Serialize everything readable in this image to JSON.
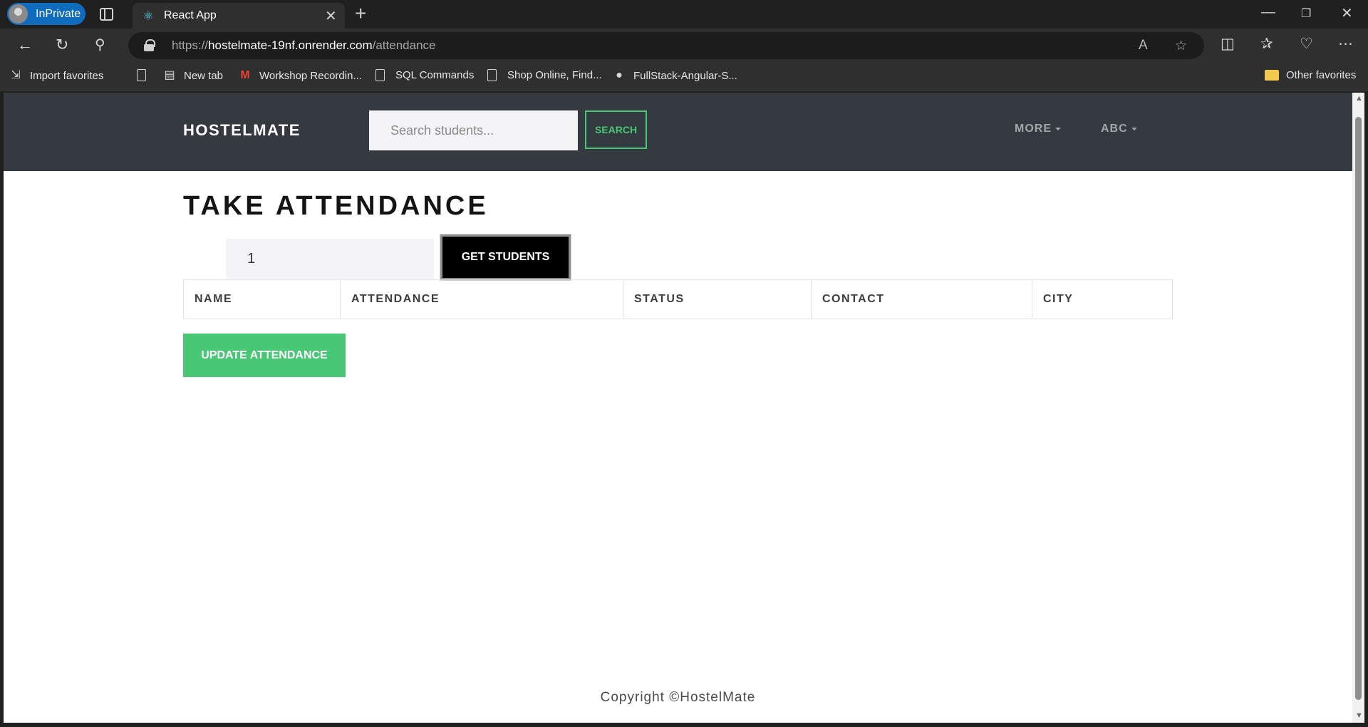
{
  "browser": {
    "profile_label": "InPrivate",
    "tab_title": "React App",
    "url_scheme": "https://",
    "url_host": "hostelmate-19nf.onrender.com",
    "url_path": "/attendance",
    "bookmarks": [
      {
        "label": "Import favorites"
      },
      {
        "label": ""
      },
      {
        "label": "New tab"
      },
      {
        "label": "Workshop Recordin..."
      },
      {
        "label": "SQL Commands"
      },
      {
        "label": "Shop Online, Find..."
      },
      {
        "label": "FullStack-Angular-S..."
      }
    ],
    "other_favorites": "Other favorites"
  },
  "navbar": {
    "brand": "HOSTELMATE",
    "search_placeholder": "Search students...",
    "search_button": "SEARCH",
    "menu_more": "MORE",
    "menu_user": "ABC"
  },
  "main": {
    "title": "TAKE ATTENDANCE",
    "room_value": "1",
    "get_students_button": "GET STUDENTS",
    "table_headers": [
      "NAME",
      "ATTENDANCE",
      "STATUS",
      "CONTACT",
      "CITY"
    ],
    "update_button": "UPDATE ATTENDANCE"
  },
  "footer": {
    "copyright": "Copyright ©HostelMate"
  },
  "colors": {
    "navbar_bg": "#343a40",
    "accent_green": "#48c774",
    "browser_blue": "#0f6cbd"
  }
}
